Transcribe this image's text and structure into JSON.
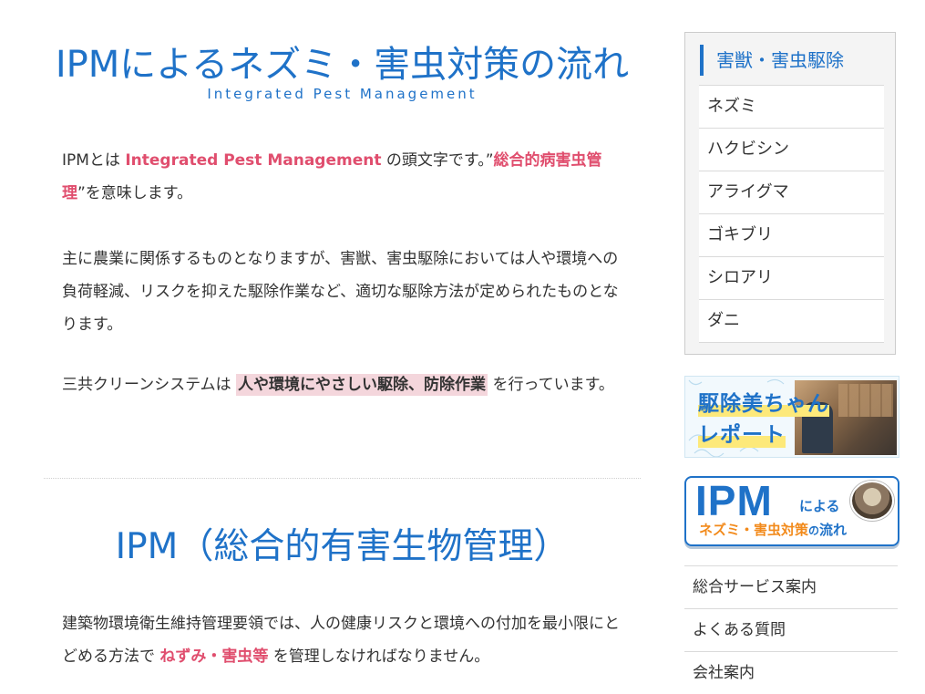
{
  "main": {
    "title": "IPMによるネズミ・害虫対策の流れ",
    "subtitle": "Integrated Pest Management",
    "intro": {
      "text1": "IPMとは ",
      "em1": "Integrated Pest Management",
      "text2": " の頭文字です。”",
      "em2": "総合的病害虫管理",
      "text3": "”を意味します。"
    },
    "para2": "主に農業に関係するものとなりますが、害獣、害虫駆除においては人や環境への負荷軽減、リスクを抑えた駆除作業など、適切な駆除方法が定められたものとなります。",
    "para3": {
      "text1": "三共クリーンシステムは ",
      "mark": "人や環境にやさしい駆除、防除作業",
      "text2": " を行っています。"
    },
    "section_title": "IPM（総合的有害生物管理）",
    "para4": {
      "text1": "建築物環境衛生維持管理要領では、人の健康リスクと環境への付加を最小限にとどめる方法で ",
      "em": "ねずみ・害虫等",
      "text2": " を管理しなければなりません。"
    }
  },
  "sidebar": {
    "category_title": "害獣・害虫駆除",
    "items": [
      {
        "label": "ネズミ"
      },
      {
        "label": "ハクビシン"
      },
      {
        "label": "アライグマ"
      },
      {
        "label": "ゴキブリ"
      },
      {
        "label": "シロアリ"
      },
      {
        "label": "ダニ"
      }
    ],
    "banner1": {
      "line1": "駆除美ちゃん",
      "line2": "レポート"
    },
    "banner2": {
      "ipm": "IPM",
      "yoru": "による",
      "sub1": "ネズミ・害虫対策",
      "sub2": "の",
      "sub3": "流れ"
    },
    "links": [
      {
        "label": "総合サービス案内"
      },
      {
        "label": "よくある質問"
      },
      {
        "label": "会社案内"
      }
    ]
  },
  "colors": {
    "accent": "#1f72c8",
    "emphasis": "#e04e6e",
    "mark_bg": "#f4d6dc",
    "banner_orange": "#f28a1b"
  }
}
